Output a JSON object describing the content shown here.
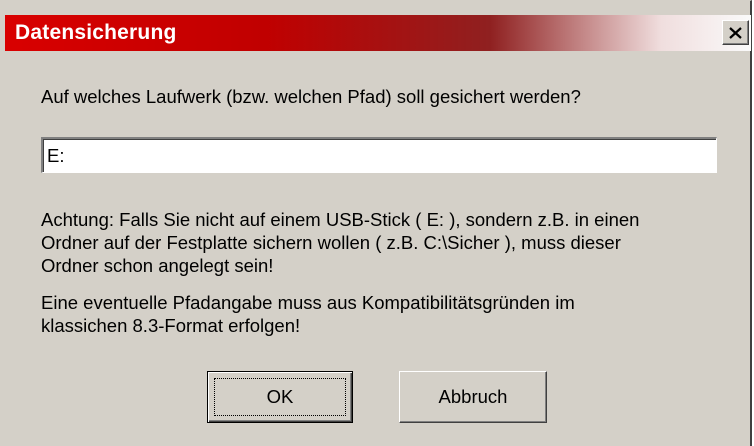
{
  "window": {
    "title": "Datensicherung",
    "close_icon": "close-x-icon",
    "title_gradient_start": "#d90000",
    "background": "#d4d0c8"
  },
  "prompt": "Auf welches Laufwerk (bzw. welchen Pfad) soll gesichert werden?",
  "path_input": {
    "value": "E:"
  },
  "warning": {
    "line1": "Achtung: Falls Sie nicht auf einem USB-Stick ( E: ), sondern z.B. in einen",
    "line2": "Ordner auf der Festplatte sichern wollen ( z.B. C:\\Sicher ),  muss dieser",
    "line3": "Ordner schon angelegt sein!"
  },
  "format_note": {
    "line1": "Eine eventuelle Pfadangabe muss aus Kompatibilitätsgründen im",
    "line2": "klassichen 8.3-Format erfolgen!"
  },
  "buttons": {
    "ok_label": "OK",
    "cancel_label": "Abbruch"
  }
}
